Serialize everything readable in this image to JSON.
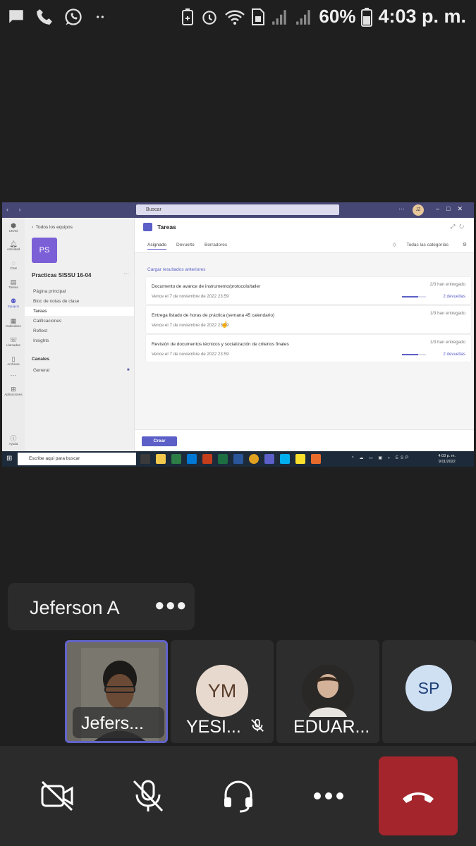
{
  "status_bar": {
    "battery_pct": "60%",
    "time": "4:03 p. m.",
    "left_icons": [
      "chat-bubble-icon",
      "phone-icon",
      "whatsapp-icon",
      "dots-icon"
    ],
    "right_icons": [
      "battery-saver-icon",
      "alarm-icon",
      "wifi-icon",
      "sim-icon",
      "signal-icon",
      "signal-icon",
      "battery-icon"
    ]
  },
  "shared_screen": {
    "search_placeholder": "Buscar",
    "avatar_initials": "JZ",
    "rail": [
      {
        "label": "UNAD",
        "icon": "teams-logo-icon"
      },
      {
        "label": "Actividad",
        "icon": "bell-icon"
      },
      {
        "label": "Chat",
        "icon": "chat-icon"
      },
      {
        "label": "Tareas",
        "icon": "tasks-icon"
      },
      {
        "label": "Equipos",
        "icon": "teams-icon"
      },
      {
        "label": "Calendario",
        "icon": "calendar-icon"
      },
      {
        "label": "Llamadas",
        "icon": "phone-icon"
      },
      {
        "label": "Archivos",
        "icon": "file-icon"
      },
      {
        "label": "Aplicaciones",
        "icon": "apps-icon"
      },
      {
        "label": "Ayuda",
        "icon": "help-icon"
      }
    ],
    "left_panel": {
      "back": "Todos los equipos",
      "team_initials": "PS",
      "team_name": "Practicas SISSU 16-04",
      "items": [
        "Página principal",
        "Bloc de notas de clase",
        "Tareas",
        "Calificaciones",
        "Reflect",
        "Insights"
      ],
      "channels_title": "Canales",
      "channel": "General"
    },
    "main": {
      "title": "Tareas",
      "tabs": [
        "Asignado",
        "Devuelto",
        "Borradores"
      ],
      "categories": "Todas las categorías",
      "load_previous": "Cargar resultados anteriores",
      "assignments": [
        {
          "title": "Documento de avance de instrumento/protocolo/taller",
          "due": "Vence el 7 de noviembre de 2022 23:59",
          "count": "2/3 han entregado",
          "returned": "2 devueltas",
          "progress": 0.67
        },
        {
          "title": "Entrega listado de horas de práctica (semana 45 calendario)",
          "due": "Vence el 7 de noviembre de 2022 23:59",
          "count": "1/3 han entregado",
          "returned": "",
          "progress": 0
        },
        {
          "title": "Revisión de documentos técnicos y socialización de criterios finales",
          "due": "Vence el 7 de noviembre de 2022 23:59",
          "count": "1/3 han entregado",
          "returned": "2 devueltas",
          "progress": 0.67
        }
      ],
      "create_button": "Crear"
    },
    "taskbar": {
      "search": "Escribe aquí para buscar",
      "lang": "ESP",
      "time": "4:03 p. m.",
      "date": "9/11/2022"
    }
  },
  "meeting": {
    "speaker_name": "Jeferson A",
    "participants": [
      {
        "label": "Jefers...",
        "type": "video"
      },
      {
        "label": "YESI...",
        "initials": "YM",
        "muted": true,
        "bg": "#e8d9cf",
        "fg": "#5a3e2b"
      },
      {
        "label": "EDUAR...",
        "type": "photo"
      },
      {
        "label": "",
        "initials": "SP",
        "bg": "#cfe0f3",
        "fg": "#1e3f78"
      }
    ],
    "controls": [
      "camera-off-icon",
      "mic-off-icon",
      "audio-headset-icon",
      "more-icon",
      "hang-up-icon"
    ]
  }
}
